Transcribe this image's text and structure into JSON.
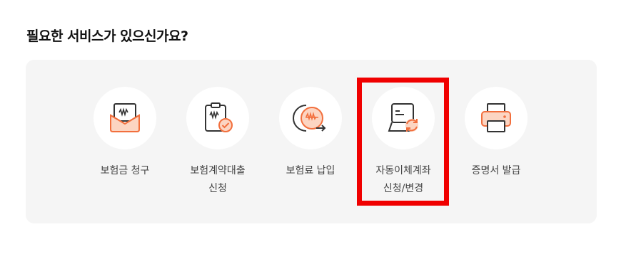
{
  "heading": "필요한 서비스가 있으신가요?",
  "services": [
    {
      "line1": "보험금 청구",
      "line2": "",
      "icon": "claim-envelope-icon"
    },
    {
      "line1": "보험계약대출",
      "line2": "신청",
      "icon": "loan-clipboard-icon"
    },
    {
      "line1": "보험료 납입",
      "line2": "",
      "icon": "premium-payment-coin-icon"
    },
    {
      "line1": "자동이체계좌",
      "line2": "신청/변경",
      "icon": "auto-transfer-card-icon"
    },
    {
      "line1": "증명서 발급",
      "line2": "",
      "icon": "certificate-printer-icon"
    }
  ],
  "colors": {
    "accent": "#f26f3d",
    "accent_light": "#fcd5c2",
    "highlight": "#f00000"
  }
}
